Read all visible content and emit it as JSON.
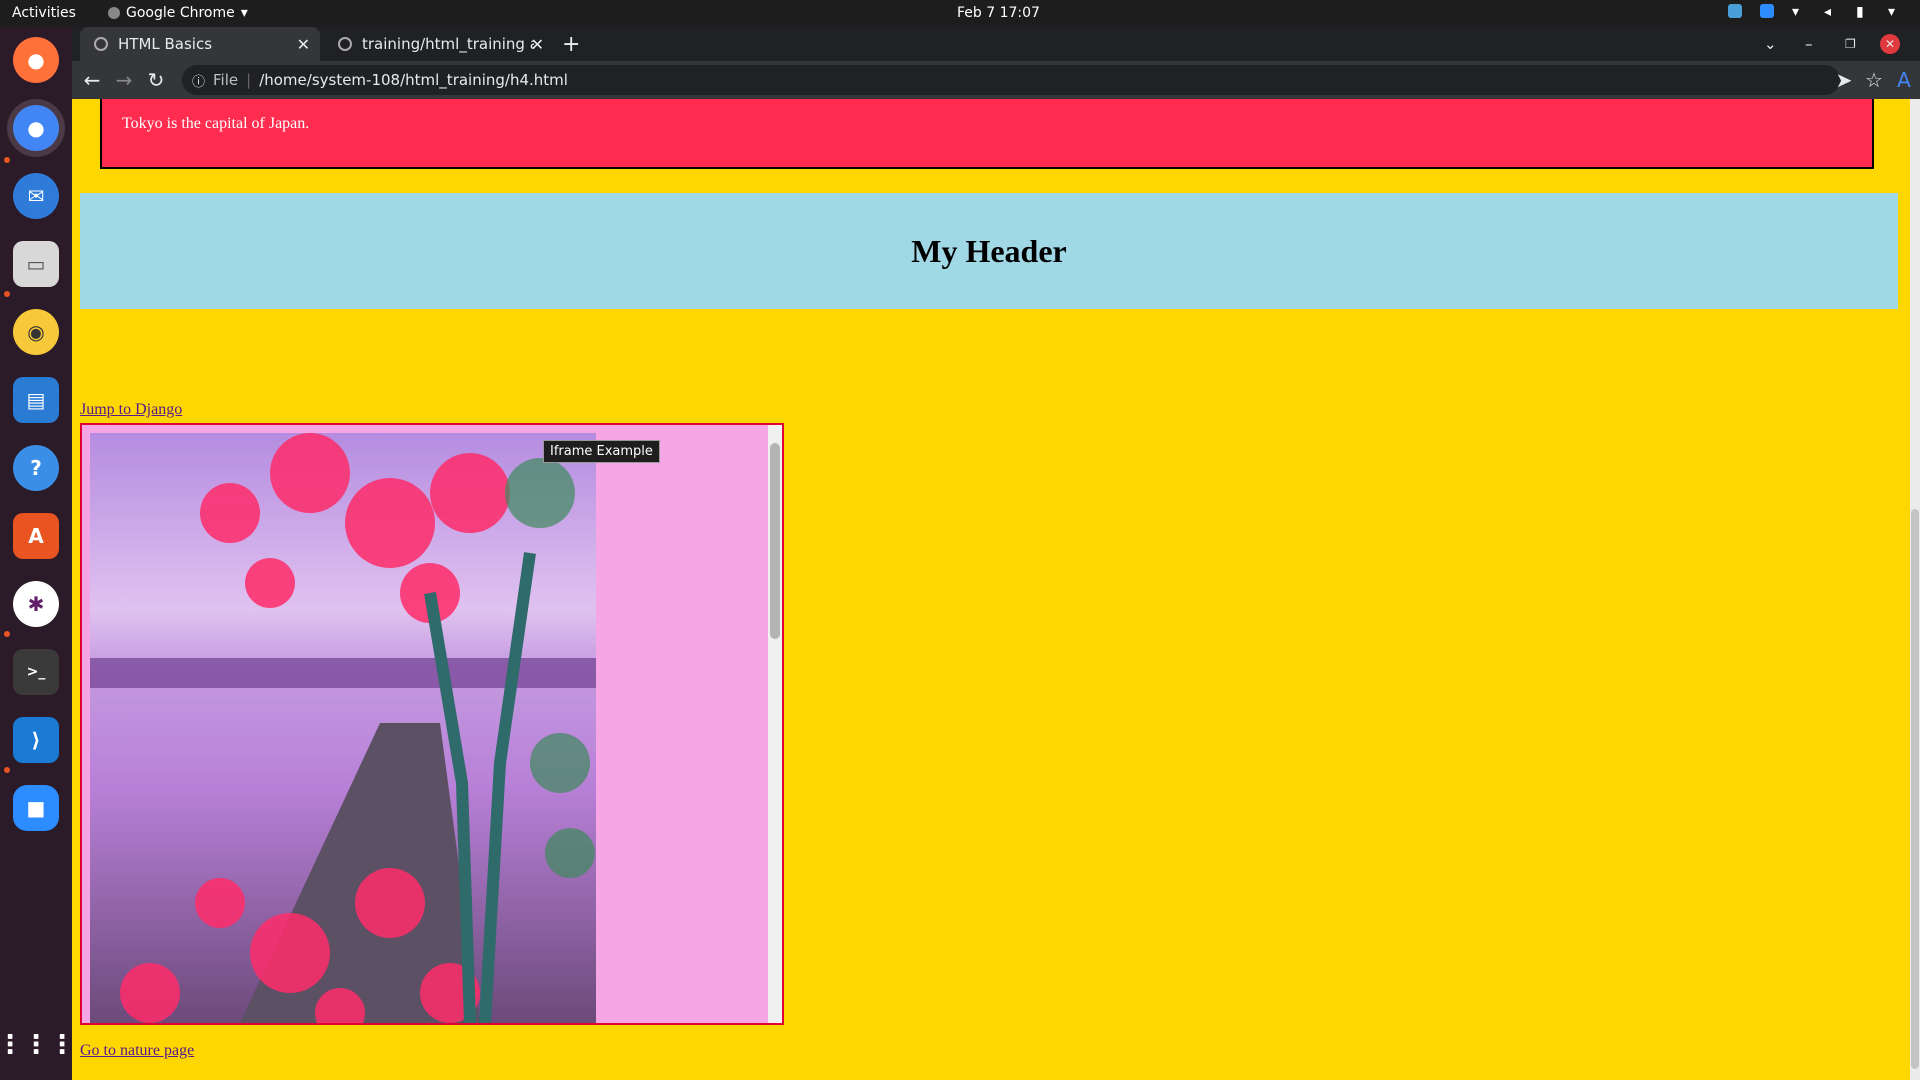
{
  "topbar": {
    "activities": "Activities",
    "app_name": "Google Chrome",
    "datetime": "Feb 7  17:07"
  },
  "browser": {
    "tabs": [
      {
        "label": "HTML Basics",
        "active": true
      },
      {
        "label": "training/html_training at",
        "active": false
      }
    ],
    "address": {
      "scheme_label": "File",
      "url": "/home/system-108/html_training/h4.html"
    }
  },
  "page": {
    "capital_text": "Tokyo is the capital of Japan.",
    "header_title": "My Header",
    "jump_link": "Jump to Django",
    "iframe_title": "Iframe Example",
    "nature_link": "Go to nature page"
  },
  "colors": {
    "page_bg": "#ffd700",
    "red_box": "#ff2c4f",
    "header_bg": "#a0d8e6",
    "iframe_bg": "#f6a6e4"
  }
}
